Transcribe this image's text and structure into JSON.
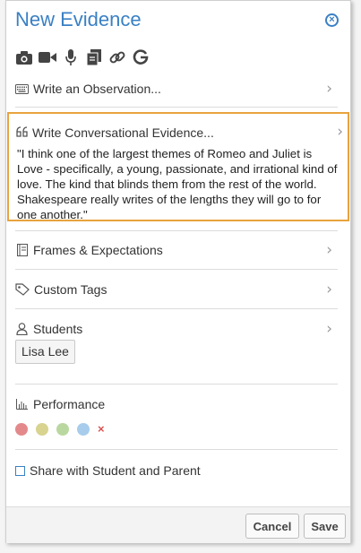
{
  "title": "New Evidence",
  "close_glyph": "×",
  "media_icons": [
    "camera-icon",
    "video-icon",
    "microphone-icon",
    "document-icon",
    "link-icon",
    "google-icon"
  ],
  "observation": {
    "label": "Write an Observation..."
  },
  "conversational": {
    "label": "Write Conversational Evidence...",
    "text": "\"I think one of the largest themes of Romeo and Juliet is Love - specifically, a young, passionate, and irrational kind of love. The kind that blinds them from the rest of the world. Shakespeare really writes of the lengths they will go to for one another.\""
  },
  "frames": {
    "label": "Frames & Expectations"
  },
  "custom_tags": {
    "label": "Custom Tags"
  },
  "students": {
    "label": "Students",
    "selected": [
      "Lisa Lee"
    ]
  },
  "performance": {
    "label": "Performance",
    "levels": [
      "#e4898b",
      "#d8d38f",
      "#b9d8a0",
      "#a8ccec"
    ],
    "clear_glyph": "×"
  },
  "share": {
    "label": "Share with Student and Parent",
    "checked": false
  },
  "footer": {
    "cancel_label": "Cancel",
    "save_label": "Save"
  },
  "colors": {
    "accent": "#3a80c4",
    "highlight": "#e8a33d"
  }
}
